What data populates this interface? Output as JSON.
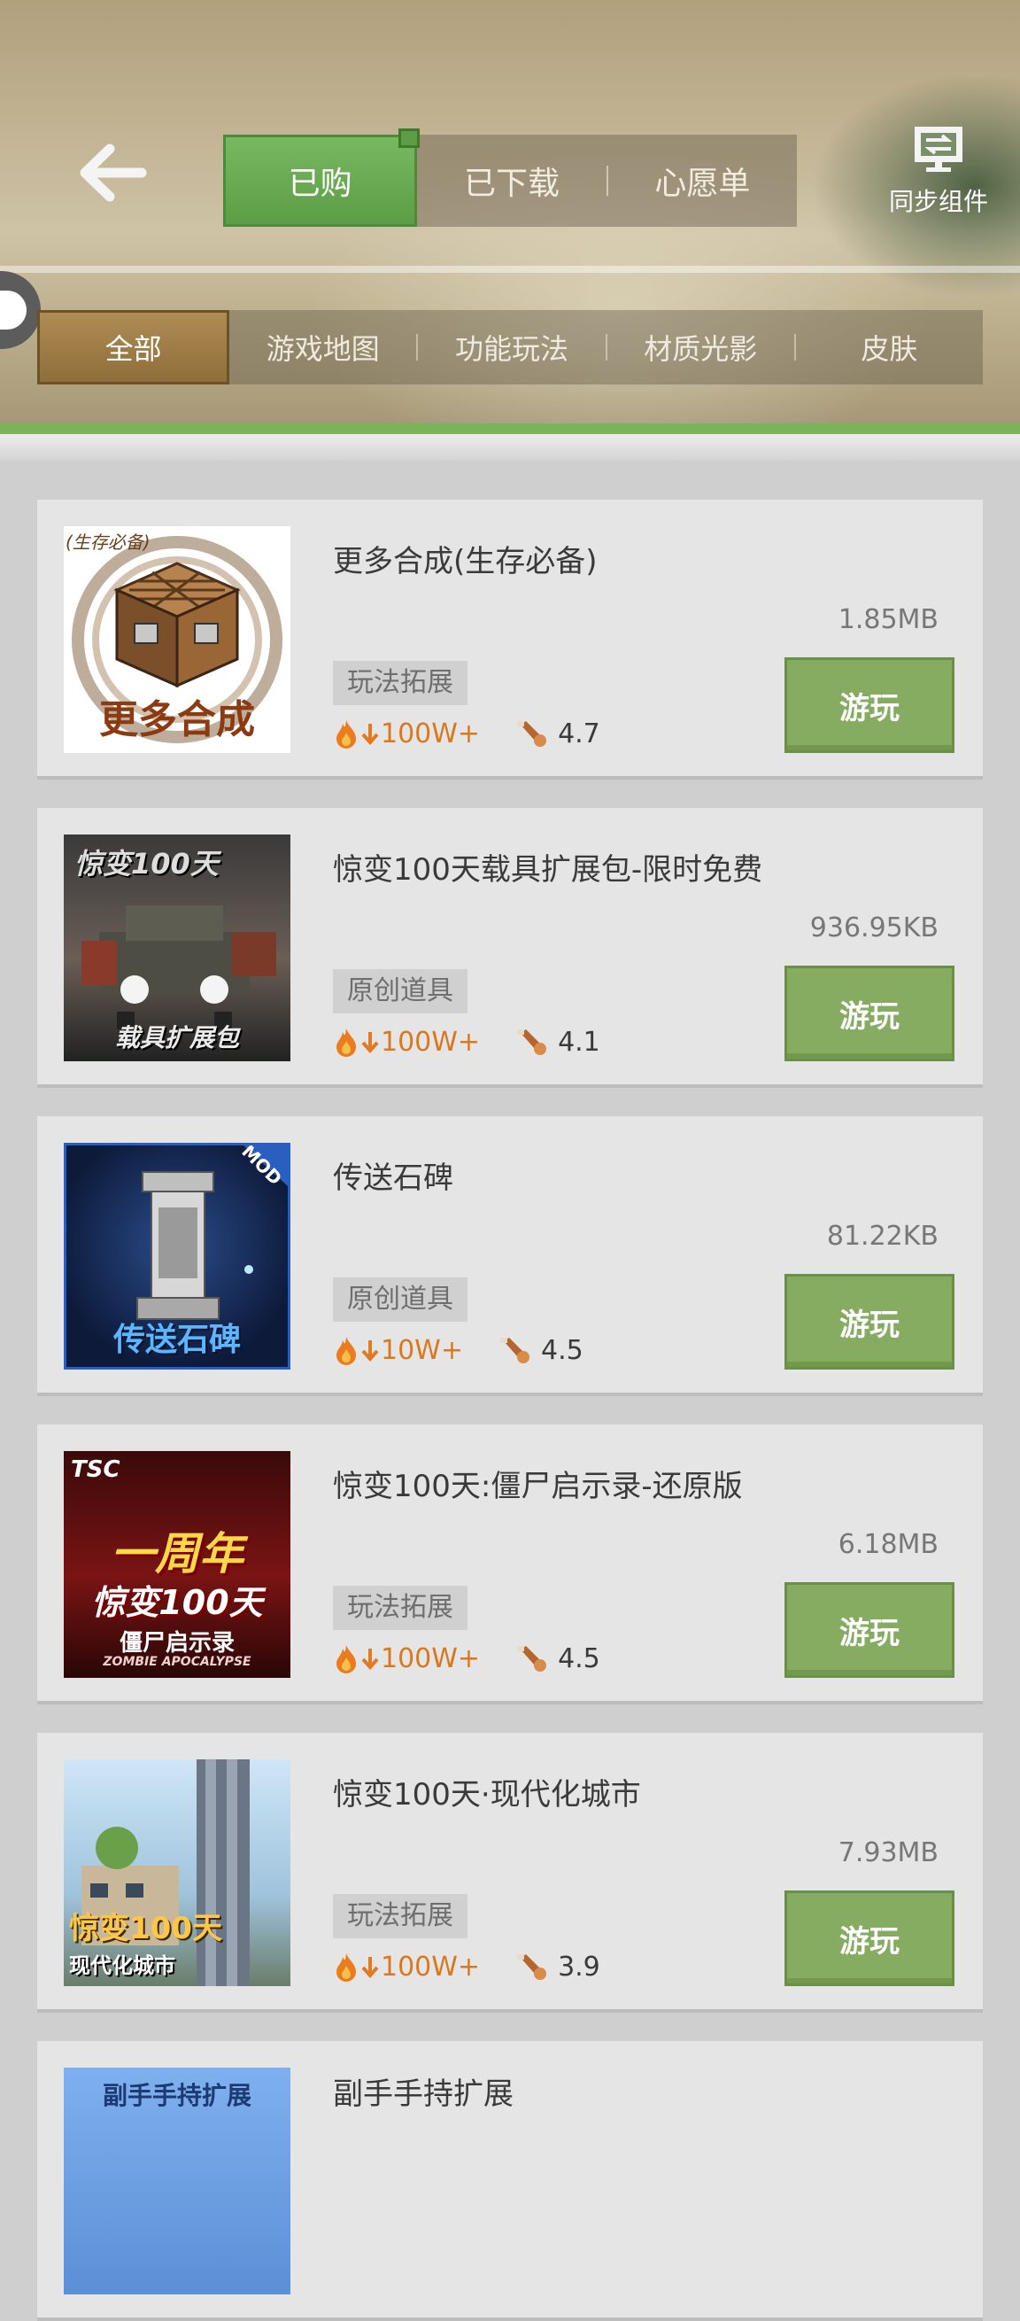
{
  "top_tabs": [
    "已购",
    "已下载",
    "心愿单"
  ],
  "sync_label": "同步组件",
  "categories": [
    "全部",
    "游戏地图",
    "功能玩法",
    "材质光影",
    "皮肤"
  ],
  "items": [
    {
      "title": "更多合成(生存必备)",
      "size": "1.85MB",
      "tag": "玩法拓展",
      "downloads": "100W+",
      "rating": "4.7",
      "button": "游玩",
      "thumb_text": "更多合成",
      "thumb_caption": "(生存必备)"
    },
    {
      "title": "惊变100天载具扩展包-限时免费",
      "size": "936.95KB",
      "tag": "原创道具",
      "downloads": "100W+",
      "rating": "4.1",
      "button": "游玩",
      "thumb_text": "惊变100天",
      "thumb_caption": "载具扩展包"
    },
    {
      "title": "传送石碑",
      "size": "81.22KB",
      "tag": "原创道具",
      "downloads": "10W+",
      "rating": "4.5",
      "button": "游玩",
      "thumb_text": "传送石碑",
      "thumb_caption": "MOD"
    },
    {
      "title": "惊变100天:僵尸启示录-还原版",
      "size": "6.18MB",
      "tag": "玩法拓展",
      "downloads": "100W+",
      "rating": "4.5",
      "button": "游玩",
      "thumb_text": "一周年",
      "thumb_caption": "惊变100天",
      "thumb_sub": "僵尸启示录",
      "thumb_sub2": "ZOMBIE APOCALYPSE",
      "thumb_badge": "TSC"
    },
    {
      "title": "惊变100天·现代化城市",
      "size": "7.93MB",
      "tag": "玩法拓展",
      "downloads": "100W+",
      "rating": "3.9",
      "button": "游玩",
      "thumb_text": "惊变100天",
      "thumb_caption": "现代化城市"
    },
    {
      "title": "副手手持扩展",
      "thumb_text": "副手手持扩展"
    }
  ],
  "colors": {
    "accent_green": "#86ac61",
    "download_orange": "#d9781f",
    "active_category": "#9c7a45"
  }
}
